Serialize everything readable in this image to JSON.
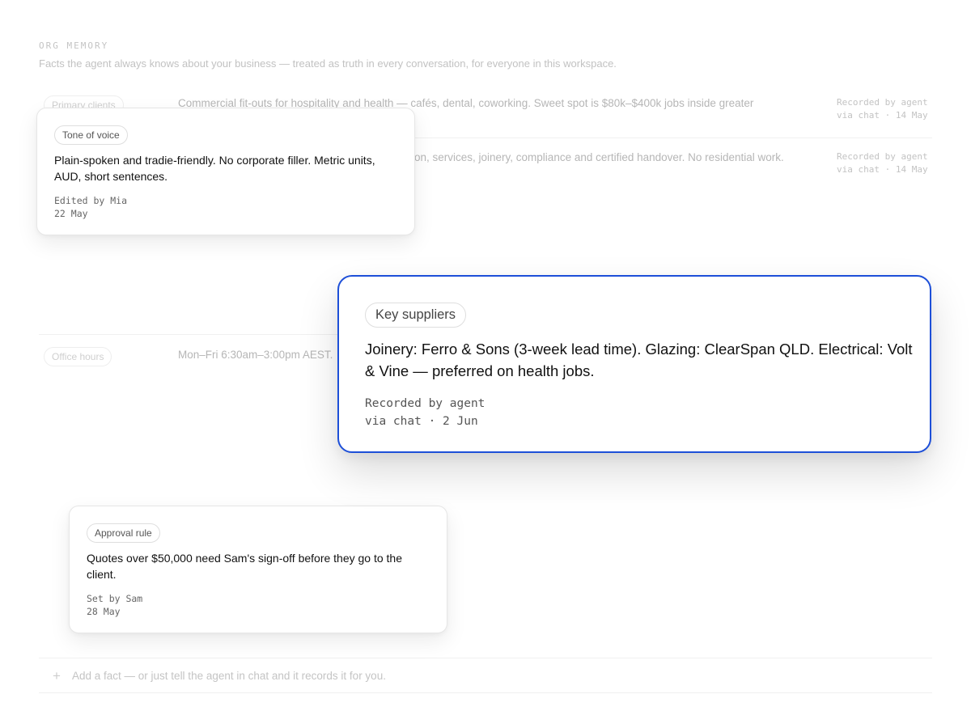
{
  "section": {
    "title": "ORG MEMORY",
    "description": "Facts the agent always knows about your business — treated as truth in every conversation, for everyone in this workspace."
  },
  "rows": [
    {
      "label": "Primary clients",
      "text": "Commercial fit-outs for hospitality and health — cafés, dental, coworking. Sweet spot is $80k–$400k jobs inside greater",
      "meta_line1": "Recorded by agent",
      "meta_line2": "via chat · 14 May"
    },
    {
      "text": "ion, services, joinery, compliance and certified handover. No residential work.",
      "meta_line1": "Recorded by agent",
      "meta_line2": "via chat · 14 May"
    },
    {
      "label": "Office hours",
      "text": "Mon–Fri 6:30am–3:00pm AEST."
    }
  ],
  "cards": {
    "tone": {
      "label": "Tone of voice",
      "body": "Plain-spoken and tradie-friendly. No corporate filler. Metric units, AUD, short sentences.",
      "meta_line1": "Edited by Mia",
      "meta_line2": "22 May"
    },
    "suppliers": {
      "label": "Key suppliers",
      "body": "Joinery: Ferro & Sons (3-week lead time). Glazing: ClearSpan QLD. Electrical: Volt & Vine — preferred on health jobs.",
      "meta_line1": "Recorded by agent",
      "meta_line2": "via chat · 2 Jun"
    },
    "approval": {
      "label": "Approval rule",
      "body": "Quotes over $50,000 need Sam's sign-off before they go to the client.",
      "meta_line1": "Set by Sam",
      "meta_line2": "28 May"
    }
  },
  "add_fact": {
    "icon": "plus-icon",
    "symbol": "+",
    "text": "Add a fact — or just tell the agent in chat and it records it for you."
  },
  "colors": {
    "accent": "#1d4fd8"
  }
}
